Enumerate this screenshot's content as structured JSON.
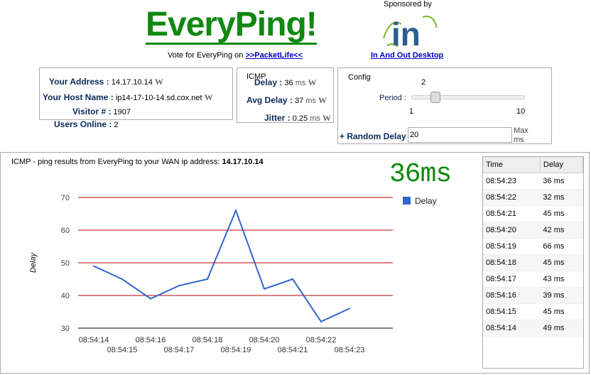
{
  "header": {
    "logo": "EveryPing!",
    "vote_text": "Vote for EveryPing on ",
    "vote_link": ">>PacketLife<<",
    "sponsored_by": "Sponsored by",
    "sponsor_logo": "in",
    "sponsor_link": "In And Out Desktop"
  },
  "info": {
    "address_label": "Your Address :",
    "address": "14.17.10.14",
    "host_label": "Your Host Name :",
    "host": "ip14-17-10-14.sd.cox.net",
    "visitor_label": "Visitor # :",
    "visitor": "1907",
    "users_label": "Users Online :",
    "users": "2",
    "wiki": "W"
  },
  "icmp": {
    "title": "ICMP",
    "delay_label": "Delay :",
    "delay": "36",
    "avg_label": "Avg Delay :",
    "avg": "37",
    "jitter_label": "Jitter :",
    "jitter": "0.25",
    "unit": "ms"
  },
  "config": {
    "title": "Config",
    "period_label": "Period :",
    "period_value": "2",
    "period_min": "1",
    "period_max": "10",
    "period_fraction": 0.111,
    "random_label": "+ Random Delay :",
    "random_value": "20",
    "random_unit": "Max ms"
  },
  "chart_title": "ICMP - ping results from EveryPing to your WAN ip address: ",
  "chart_ip": "14.17.10.14",
  "current": "36ms",
  "chart_data": {
    "type": "line",
    "ylabel": "Delay",
    "ylim": [
      30,
      70
    ],
    "yticks": [
      30,
      40,
      50,
      60,
      70
    ],
    "legend": "Delay",
    "legend_position": "right",
    "x": [
      "08:54:14",
      "08:54:15",
      "08:54:16",
      "08:54:17",
      "08:54:18",
      "08:54:19",
      "08:54:20",
      "08:54:21",
      "08:54:22",
      "08:54:23"
    ],
    "values": [
      49,
      45,
      39,
      43,
      45,
      66,
      42,
      45,
      32,
      36
    ],
    "color": "#3366cc",
    "gridcolor": "#bb0000"
  },
  "table": {
    "headers": [
      "Time",
      "Delay"
    ],
    "rows": [
      [
        "08:54:23",
        "36 ms"
      ],
      [
        "08:54:22",
        "32 ms"
      ],
      [
        "08:54:21",
        "45 ms"
      ],
      [
        "08:54:20",
        "42 ms"
      ],
      [
        "08:54:19",
        "66 ms"
      ],
      [
        "08:54:18",
        "45 ms"
      ],
      [
        "08:54:17",
        "43 ms"
      ],
      [
        "08:54:16",
        "39 ms"
      ],
      [
        "08:54:15",
        "45 ms"
      ],
      [
        "08:54:14",
        "49 ms"
      ]
    ]
  }
}
